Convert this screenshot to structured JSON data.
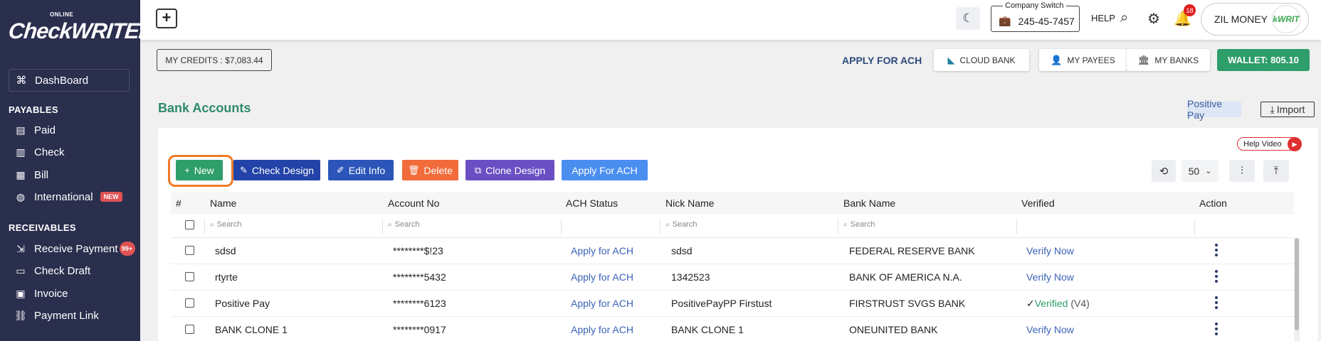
{
  "sidebar": {
    "logo_online": "ONLINE",
    "logo_brand": "CheckWRITER",
    "dashboard": "DashBoard",
    "payables_title": "PAYABLES",
    "payables": [
      {
        "label": "Paid",
        "icon": "receipt-icon"
      },
      {
        "label": "Check",
        "icon": "check-doc-icon"
      },
      {
        "label": "Bill",
        "icon": "bill-icon"
      },
      {
        "label": "International",
        "icon": "globe-icon",
        "badge": "NEW"
      }
    ],
    "receivables_title": "RECEIVABLES",
    "receivables": [
      {
        "label": "Receive Payment",
        "icon": "receive-icon",
        "badge": "99+"
      },
      {
        "label": "Check Draft",
        "icon": "check-draft-icon"
      },
      {
        "label": "Invoice",
        "icon": "invoice-icon"
      },
      {
        "label": "Payment Link",
        "icon": "link-icon"
      }
    ]
  },
  "header": {
    "company_switch_label": "Company Switch",
    "company_switch_value": "245-45-7457",
    "help": "HELP",
    "notification_count": "18",
    "account_name": "ZIL MONEY",
    "account_logo": "kWRIT"
  },
  "subbar": {
    "credits": "MY CREDITS : $7,083.44",
    "apply_for_ach": "APPLY FOR ACH",
    "cloud_bank": "CLOUD BANK",
    "my_payees": "MY PAYEES",
    "my_banks": "MY BANKS",
    "wallet": "WALLET: 805.10"
  },
  "page": {
    "title": "Bank Accounts",
    "positive_pay": "Positive Pay",
    "import": "Import",
    "help_video": "Help Video"
  },
  "actions": {
    "new": "New",
    "check_design": "Check Design",
    "edit_info": "Edit Info",
    "delete": "Delete",
    "clone_design": "Clone Design",
    "apply_for_ach": "Apply For ACH",
    "page_size": "50"
  },
  "colors": {
    "sidebar": "#2b2f4e",
    "new": "#2e9e6a",
    "check_design": "#2443a8",
    "edit_info": "#2b55b8",
    "delete": "#f26b3a",
    "clone_design": "#6a4fc4",
    "apply_ach": "#4a8ef0",
    "highlight": "#ef7a26"
  },
  "table": {
    "columns": [
      "#",
      "Name",
      "Account No",
      "ACH Status",
      "Nick Name",
      "Bank Name",
      "Verified",
      "Action"
    ],
    "search_placeholder": "Search",
    "rows": [
      {
        "name": "sdsd",
        "account": "********$!23",
        "ach": "Apply for ACH",
        "nick": "sdsd",
        "bank": "FEDERAL RESERVE BANK",
        "verified": "Verify Now",
        "version": ""
      },
      {
        "name": "rtyrte",
        "account": "********5432",
        "ach": "Apply for ACH",
        "nick": "1342523",
        "bank": "BANK OF AMERICA N.A.",
        "verified": "Verify Now",
        "version": ""
      },
      {
        "name": "Positive Pay",
        "account": "********6123",
        "ach": "Apply for ACH",
        "nick": "PositivePayPP Firstust",
        "bank": "FIRSTRUST SVGS BANK",
        "verified": "Verified",
        "version": "(V4)"
      },
      {
        "name": "BANK CLONE 1",
        "account": "********0917",
        "ach": "Apply for ACH",
        "nick": "BANK CLONE 1",
        "bank": "ONEUNITED BANK",
        "verified": "Verify Now",
        "version": ""
      }
    ]
  }
}
